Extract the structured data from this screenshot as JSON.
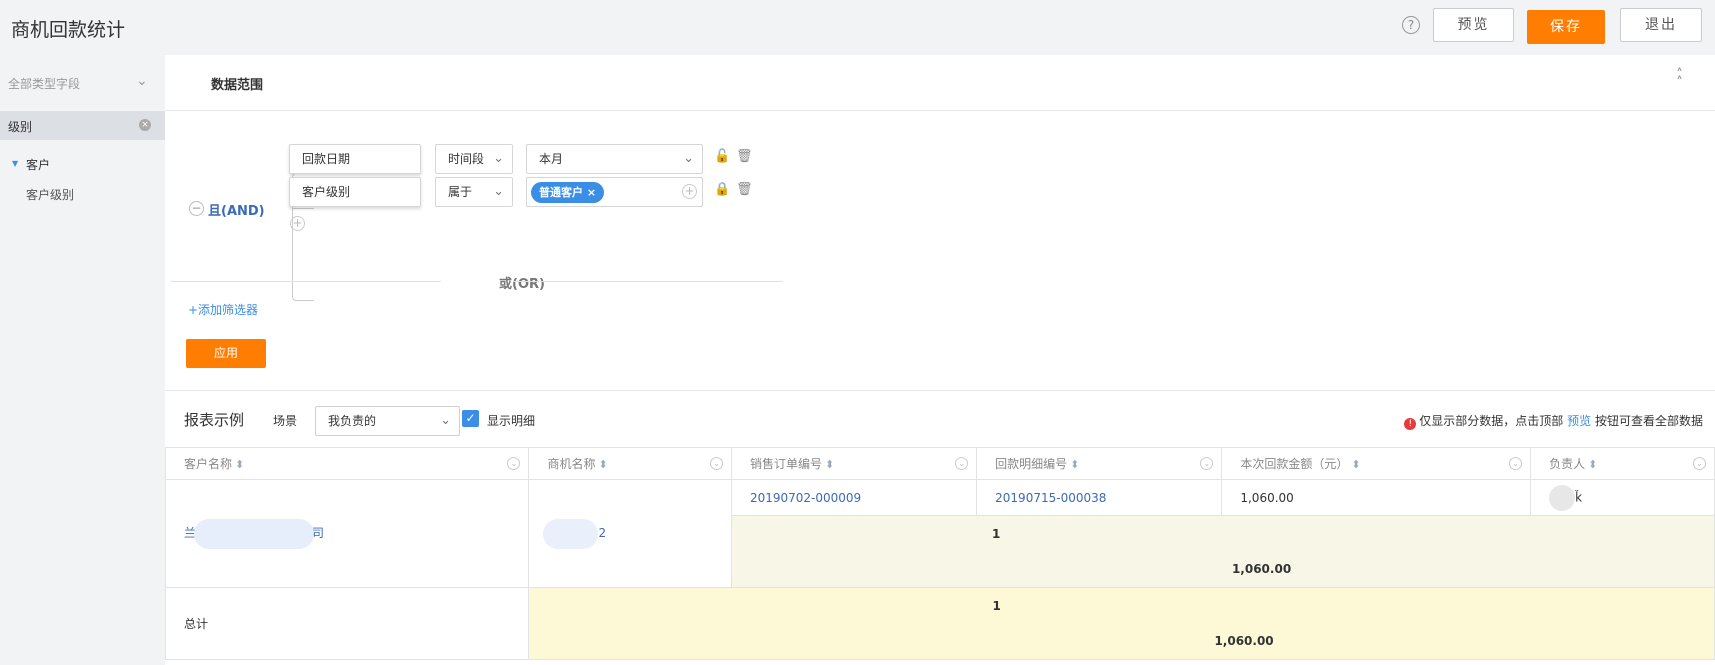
{
  "header": {
    "title": "商机回款统计",
    "help": "?",
    "preview_label": "预览",
    "save_label": "保存",
    "exit_label": "退出"
  },
  "sidebar": {
    "field_type": "全部类型字段",
    "search_value": "级别",
    "tree": {
      "parent": "客户",
      "child": "客户级别"
    }
  },
  "filters": {
    "section_title": "数据范围",
    "logic": "且(AND)",
    "rows": [
      {
        "field": "回款日期",
        "operator": "时间段",
        "value": "本月"
      },
      {
        "field": "客户级别",
        "operator": "属于",
        "tag": "普通客户"
      }
    ],
    "or_label": "或(OR)",
    "add_filter": "+添加筛选器",
    "apply_label": "应用"
  },
  "report": {
    "title": "报表示例",
    "scene_label": "场景",
    "scene_value": "我负责的",
    "show_detail": "显示明细",
    "notice_pre": "仅显示部分数据，点击顶部",
    "notice_link": "预览",
    "notice_post": "按钮可查看全部数据",
    "columns": [
      "客户名称",
      "商机名称",
      "销售订单编号",
      "回款明细编号",
      "本次回款金额（元）",
      "负责人"
    ],
    "row": {
      "customer_prefix": "兰",
      "customer_suffix": "司",
      "opportunity_suffix": "2",
      "order_no": "20190702-000009",
      "detail_no": "20190715-000038",
      "amount": "1,060.00",
      "owner_suffix": "ǩ"
    },
    "subtotal": {
      "count": "1",
      "amount": "1,060.00"
    },
    "total": {
      "label": "总计",
      "count": "1",
      "amount": "1,060.00"
    }
  }
}
